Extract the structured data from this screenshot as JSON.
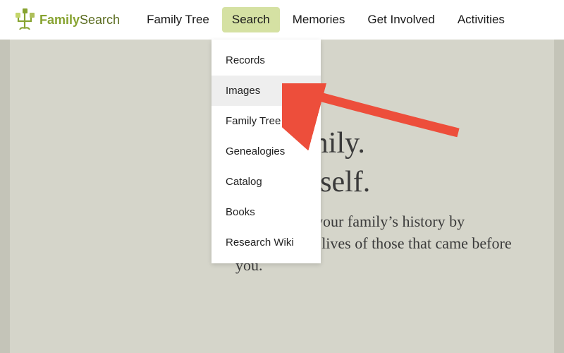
{
  "brand": {
    "part1": "Family",
    "part2": "Search"
  },
  "nav": {
    "items": [
      {
        "label": "Family Tree"
      },
      {
        "label": "Search"
      },
      {
        "label": "Memories"
      },
      {
        "label": "Get Involved"
      },
      {
        "label": "Activities"
      }
    ],
    "active_index": 1
  },
  "dropdown": {
    "items": [
      {
        "label": "Records"
      },
      {
        "label": "Images"
      },
      {
        "label": "Family Tree"
      },
      {
        "label": "Genealogies"
      },
      {
        "label": "Catalog"
      },
      {
        "label": "Books"
      },
      {
        "label": "Research Wiki"
      }
    ],
    "hover_index": 1
  },
  "hero": {
    "title_line1": "our family.",
    "title_line2": "er yourself.",
    "visible_title_fragment": "our family.\ner yourself.",
    "subtitle": "Bring to life your family’s history by exploring the lives of those that came before you."
  },
  "colors": {
    "accent_green": "#87a330",
    "nav_highlight": "#d5e1a3",
    "page_bg": "#c4c4b8",
    "hero_bg": "#d5d5ca",
    "arrow": "#ed4e3b"
  }
}
